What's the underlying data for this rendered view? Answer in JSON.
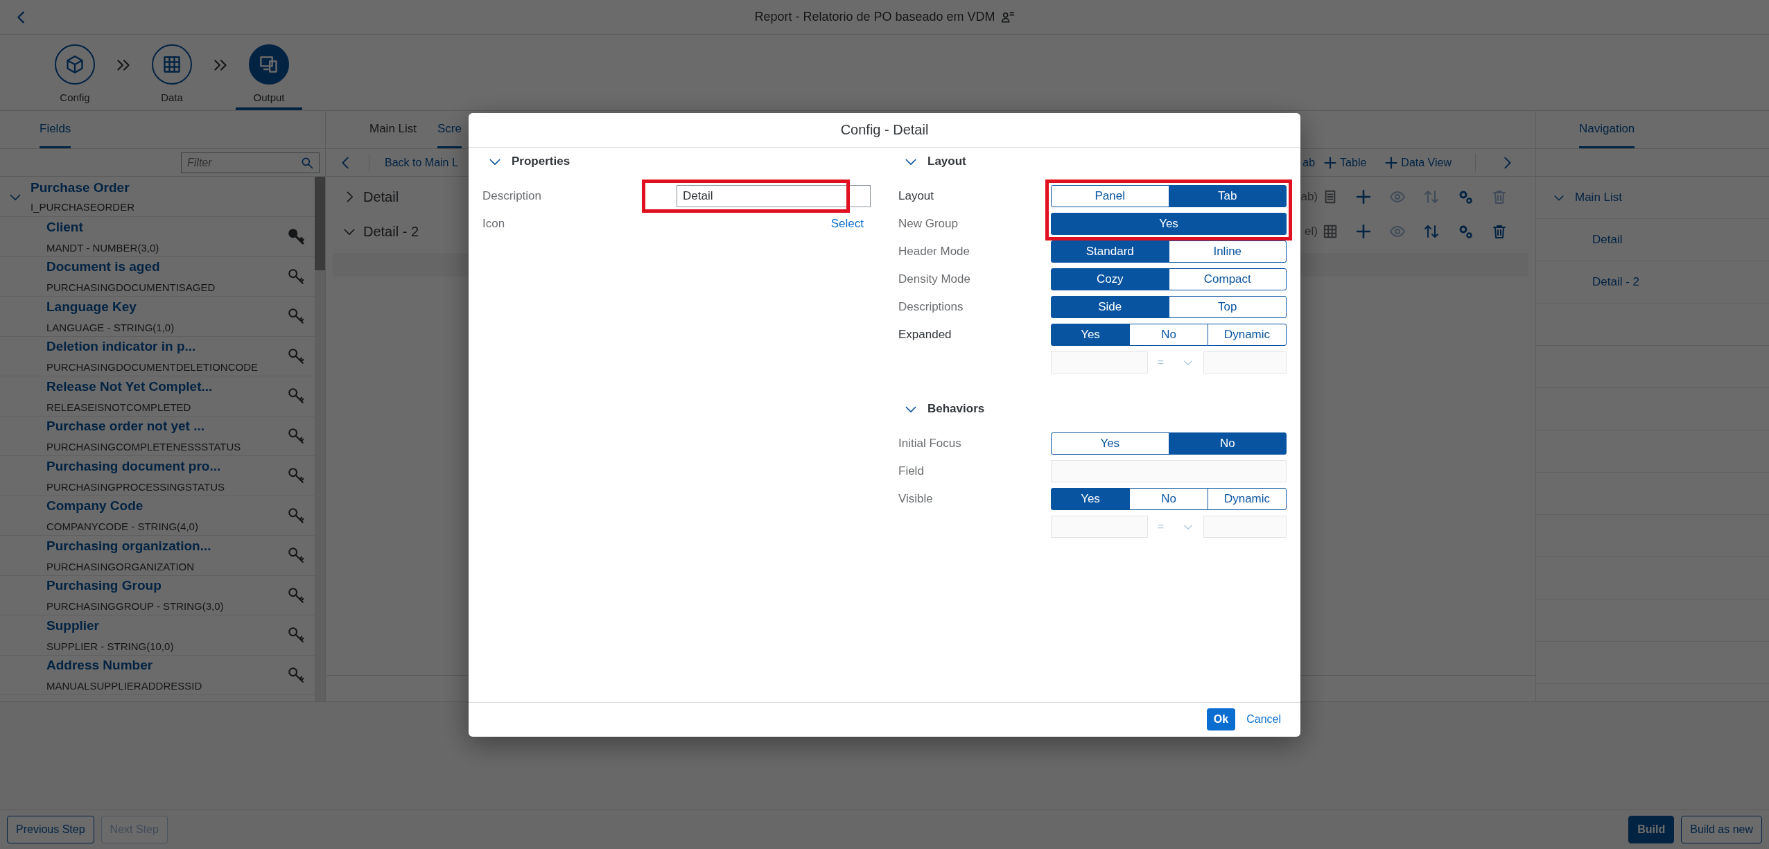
{
  "header": {
    "title": "Report - Relatorio de PO baseado em VDM"
  },
  "steps": [
    {
      "label": "Config",
      "selected": false
    },
    {
      "label": "Data",
      "selected": false
    },
    {
      "label": "Output",
      "selected": true
    }
  ],
  "fields_panel": {
    "tabs": [
      {
        "label": "Fields",
        "selected": true
      }
    ],
    "filter": {
      "placeholder": "Filter"
    },
    "entity": {
      "title": "Purchase Order",
      "subtitle": "I_PURCHASEORDER",
      "expanded": true
    },
    "fields": [
      {
        "title": "Client",
        "subtitle": "MANDT - NUMBER(3,0)",
        "key": true
      },
      {
        "title": "Document is aged",
        "subtitle": "PURCHASINGDOCUMENTISAGED",
        "key": false
      },
      {
        "title": "Language Key",
        "subtitle": "LANGUAGE - STRING(1,0)",
        "key": false
      },
      {
        "title": "Deletion indicator in p...",
        "subtitle": "PURCHASINGDOCUMENTDELETIONCODE",
        "key": false
      },
      {
        "title": "Release Not Yet Complet...",
        "subtitle": "RELEASEISNOTCOMPLETED",
        "key": false
      },
      {
        "title": "Purchase order not yet ...",
        "subtitle": "PURCHASINGCOMPLETENESSSTATUS",
        "key": false
      },
      {
        "title": "Purchasing document pro...",
        "subtitle": "PURCHASINGPROCESSINGSTATUS",
        "key": false
      },
      {
        "title": "Company Code",
        "subtitle": "COMPANYCODE - STRING(4,0)",
        "key": false
      },
      {
        "title": "Purchasing organization...",
        "subtitle": "PURCHASINGORGANIZATION",
        "key": false
      },
      {
        "title": "Purchasing Group",
        "subtitle": "PURCHASINGGROUP - STRING(3,0)",
        "key": false
      },
      {
        "title": "Supplier",
        "subtitle": "SUPPLIER - STRING(10,0)",
        "key": false
      },
      {
        "title": "Address Number",
        "subtitle": "MANUALSUPPLIERADDRESSID",
        "key": false
      }
    ]
  },
  "screens_panel": {
    "tabs": [
      {
        "label": "Main List",
        "selected": false
      },
      {
        "label": "Scre",
        "selected": true
      }
    ],
    "toolbar": {
      "back_label": "Back to Main L",
      "buttons": [
        {
          "label": "ab",
          "kind": "text"
        },
        {
          "label": "Table",
          "kind": "add"
        },
        {
          "label": "Data View",
          "kind": "add"
        }
      ]
    },
    "rows": [
      {
        "label": "Detail",
        "expanded": false,
        "type_text": "ab)",
        "kind": "list",
        "actions": [
          {
            "enabled": true
          },
          {
            "enabled": false
          },
          {
            "enabled": false
          },
          {
            "enabled": true
          },
          {
            "enabled": false
          }
        ]
      },
      {
        "label": "Detail - 2",
        "expanded": true,
        "type_text": "el)",
        "kind": "table",
        "actions": [
          {
            "enabled": true
          },
          {
            "enabled": false
          },
          {
            "enabled": true
          },
          {
            "enabled": true
          },
          {
            "enabled": true
          }
        ]
      }
    ]
  },
  "navigation_panel": {
    "tabs": [
      {
        "label": "Navigation",
        "selected": true
      }
    ],
    "tree": [
      {
        "label": "Main List",
        "expanded": true,
        "children": [
          {
            "label": "Detail"
          },
          {
            "label": "Detail - 2"
          }
        ]
      }
    ]
  },
  "modal": {
    "title": "Config - Detail",
    "columns": [
      {
        "sections": [
          {
            "title": "Properties",
            "expanded": true,
            "rows": [
              {
                "kind": "input",
                "label": "Description",
                "value": "Detail",
                "emphasized": false,
                "highlighted": true
              },
              {
                "kind": "link",
                "label": "Icon",
                "link": "Select",
                "emphasized": false
              }
            ]
          }
        ]
      },
      {
        "sections": [
          {
            "title": "Layout",
            "expanded": true,
            "rows": [
              {
                "kind": "segmented",
                "label": "Layout",
                "emphasized": true,
                "highlighted": true,
                "options": [
                  {
                    "label": "Panel",
                    "selected": false
                  },
                  {
                    "label": "Tab",
                    "selected": true
                  }
                ]
              },
              {
                "kind": "segmented",
                "label": "New Group",
                "emphasized": false,
                "highlighted": true,
                "options": [
                  {
                    "label": "Yes",
                    "selected": true
                  }
                ]
              },
              {
                "kind": "segmented",
                "label": "Header Mode",
                "emphasized": false,
                "options": [
                  {
                    "label": "Standard",
                    "selected": true
                  },
                  {
                    "label": "Inline",
                    "selected": false
                  }
                ]
              },
              {
                "kind": "segmented",
                "label": "Density Mode",
                "emphasized": false,
                "options": [
                  {
                    "label": "Cozy",
                    "selected": true
                  },
                  {
                    "label": "Compact",
                    "selected": false
                  }
                ]
              },
              {
                "kind": "segmented",
                "label": "Descriptions",
                "emphasized": false,
                "options": [
                  {
                    "label": "Side",
                    "selected": true
                  },
                  {
                    "label": "Top",
                    "selected": false
                  }
                ]
              },
              {
                "kind": "segmented",
                "label": "Expanded",
                "emphasized": true,
                "options": [
                  {
                    "label": "Yes",
                    "selected": true
                  },
                  {
                    "label": "No",
                    "selected": false
                  },
                  {
                    "label": "Dynamic",
                    "selected": false
                  }
                ]
              },
              {
                "kind": "condition",
                "operator": "="
              }
            ]
          },
          {
            "title": "Behaviors",
            "expanded": true,
            "rows": [
              {
                "kind": "segmented",
                "label": "Initial Focus",
                "emphasized": false,
                "options": [
                  {
                    "label": "Yes",
                    "selected": false
                  },
                  {
                    "label": "No",
                    "selected": true
                  }
                ]
              },
              {
                "kind": "input",
                "label": "Field",
                "emphasized": false
              },
              {
                "kind": "segmented",
                "label": "Visible",
                "emphasized": false,
                "options": [
                  {
                    "label": "Yes",
                    "selected": true
                  },
                  {
                    "label": "No",
                    "selected": false
                  },
                  {
                    "label": "Dynamic",
                    "selected": false
                  }
                ]
              },
              {
                "kind": "condition",
                "operator": "="
              }
            ]
          }
        ]
      }
    ],
    "buttons": [
      {
        "label": "Ok",
        "kind": "emphasized"
      },
      {
        "label": "Cancel",
        "kind": "transparent"
      }
    ]
  },
  "footer": {
    "buttons": [
      {
        "label": "Previous Step",
        "kind": "default",
        "disabled": false
      },
      {
        "label": "Next Step",
        "kind": "default",
        "disabled": true
      }
    ],
    "right_buttons": [
      {
        "label": "Build",
        "kind": "emphasized",
        "disabled": false
      },
      {
        "label": "Build as new",
        "kind": "default",
        "disabled": false
      }
    ]
  }
}
